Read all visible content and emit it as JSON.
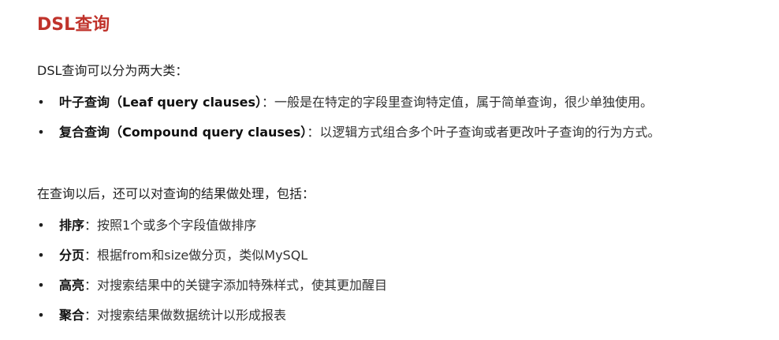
{
  "title": "DSL查询",
  "intro": "DSL查询可以分为两大类：",
  "query_types": [
    {
      "term": "叶子查询（Leaf query clauses）",
      "desc": "：一般是在特定的字段里查询特定值，属于简单查询，很少单独使用。"
    },
    {
      "term": "复合查询（Compound query clauses）",
      "desc": "：以逻辑方式组合多个叶子查询或者更改叶子查询的行为方式。"
    }
  ],
  "after": "在查询以后，还可以对查询的结果做处理，包括：",
  "processing": [
    {
      "term": "排序",
      "desc": "：按照1个或多个字段值做排序"
    },
    {
      "term": "分页",
      "desc": "：根据from和size做分页，类似MySQL"
    },
    {
      "term": "高亮",
      "desc": "：对搜索结果中的关键字添加特殊样式，使其更加醒目"
    },
    {
      "term": "聚合",
      "desc": "：对搜索结果做数据统计以形成报表"
    }
  ],
  "bullet_symbol": "•",
  "colors": {
    "title": "#c0332b",
    "text": "#1f1f1f"
  }
}
